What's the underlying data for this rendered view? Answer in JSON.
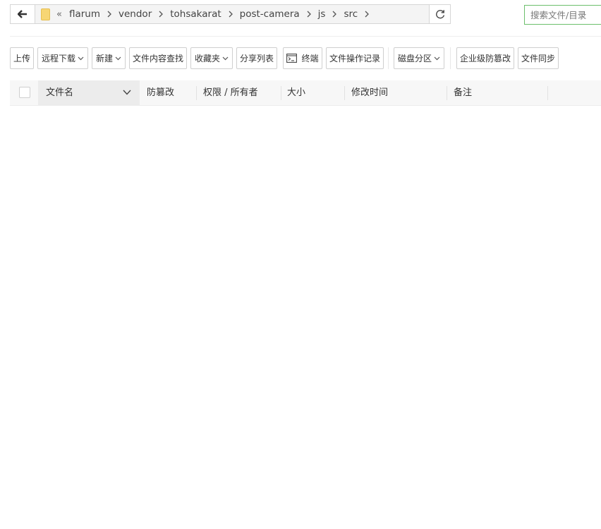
{
  "address_bar": {
    "overflow_indicator": "«",
    "crumbs": [
      "flarum",
      "vendor",
      "tohsakarat",
      "post-camera",
      "js",
      "src"
    ]
  },
  "search": {
    "placeholder": "搜索文件/目录"
  },
  "toolbar": {
    "upload": "上传",
    "remote_download": "远程下载",
    "new": "新建",
    "content_search": "文件内容查找",
    "favorites": "收藏夹",
    "share_list": "分享列表",
    "terminal": "终端",
    "operation_log": "文件操作记录",
    "disk_partition": "磁盘分区",
    "enterprise_tamper": "企业级防篡改",
    "file_sync": "文件同步"
  },
  "table": {
    "columns": {
      "name": "文件名",
      "tamper": "防篡改",
      "permission": "权限 / 所有者",
      "size": "大小",
      "modified": "修改时间",
      "remark": "备注"
    }
  },
  "colors": {
    "accent": "#20a53a",
    "search_border": "#6cbf6c",
    "folder": "#f7d674"
  }
}
